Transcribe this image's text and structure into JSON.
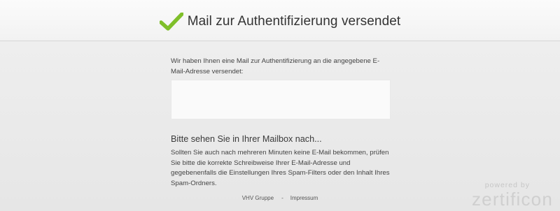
{
  "header": {
    "title": "Mail zur Authentifizierung versendet",
    "icon": "checkmark-icon",
    "icon_color": "#7fbf2a"
  },
  "main": {
    "intro_text": "Wir haben Ihnen eine Mail zur Authentifizierung an die angegebene E-Mail-Adresse versendet:",
    "email_value": "",
    "subheading": "Bitte sehen Sie in Ihrer Mailbox nach...",
    "hint_text": "Sollten Sie auch nach mehreren Minuten keine E-Mail bekommen, prüfen Sie bitte die korrekte Schreibweise Ihrer E-Mail-Adresse und gegebenenfalls die Einstellungen Ihres Spam-Filters oder den Inhalt Ihres Spam-Ordners."
  },
  "footer": {
    "link_company": "VHV Gruppe",
    "separator": "-",
    "link_imprint": "Impressum"
  },
  "brand": {
    "powered_by": "powered by",
    "name": "zertificon"
  }
}
